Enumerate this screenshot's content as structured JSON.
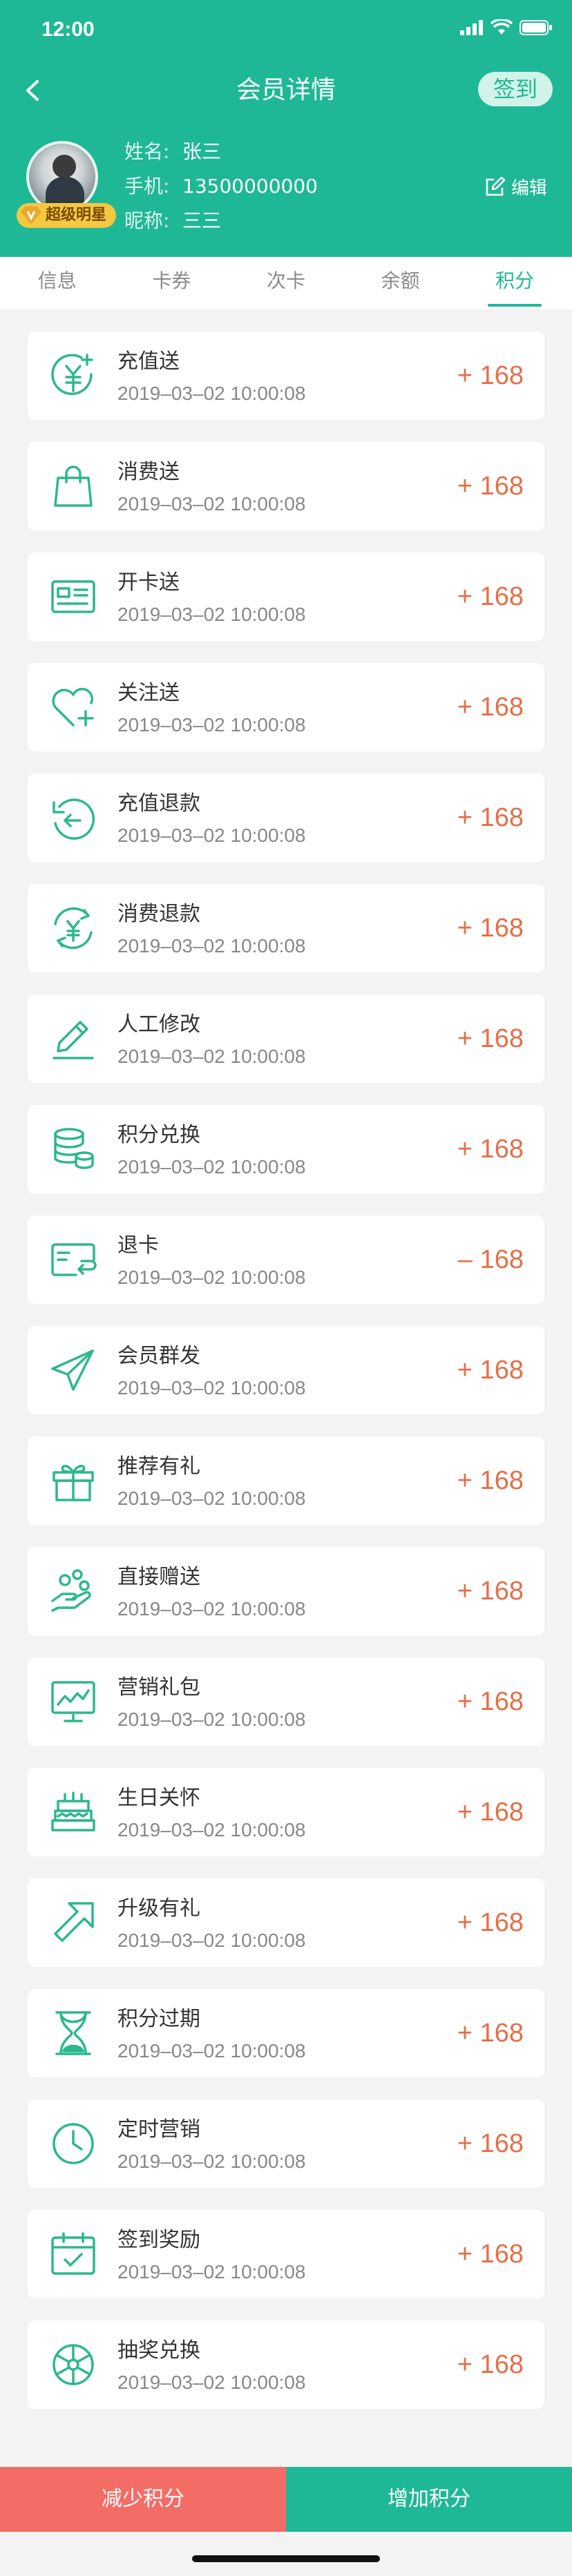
{
  "status_bar": {
    "time": "12:00"
  },
  "navbar": {
    "title": "会员详情",
    "signin_label": "签到"
  },
  "member": {
    "badge": "超级明星",
    "name_label": "姓名:",
    "name": "张三",
    "phone_label": "手机:",
    "phone": "13500000000",
    "nick_label": "昵称:",
    "nick": "三三",
    "edit_label": "编辑"
  },
  "tabs": [
    {
      "label": "信息"
    },
    {
      "label": "卡券"
    },
    {
      "label": "次卡"
    },
    {
      "label": "余额"
    },
    {
      "label": "积分",
      "active": true
    }
  ],
  "records": [
    {
      "icon": "recharge-gift-icon",
      "name": "充值送",
      "date": "2019–03–02  10:00:08",
      "amount": "+ 168"
    },
    {
      "icon": "shopping-bag-icon",
      "name": "消费送",
      "date": "2019–03–02  10:00:08",
      "amount": "+ 168"
    },
    {
      "icon": "member-card-icon",
      "name": "开卡送",
      "date": "2019–03–02  10:00:08",
      "amount": "+ 168"
    },
    {
      "icon": "heart-plus-icon",
      "name": "关注送",
      "date": "2019–03–02  10:00:08",
      "amount": "+ 168"
    },
    {
      "icon": "refund-arrow-icon",
      "name": "充值退款",
      "date": "2019–03–02  10:00:08",
      "amount": "+ 168"
    },
    {
      "icon": "yuan-refund-icon",
      "name": "消费退款",
      "date": "2019–03–02  10:00:08",
      "amount": "+ 168"
    },
    {
      "icon": "pencil-icon",
      "name": "人工修改",
      "date": "2019–03–02  10:00:08",
      "amount": "+ 168"
    },
    {
      "icon": "coins-stack-icon",
      "name": "积分兑换",
      "date": "2019–03–02  10:00:08",
      "amount": "+ 168"
    },
    {
      "icon": "card-return-icon",
      "name": "退卡",
      "date": "2019–03–02  10:00:08",
      "amount": "– 168"
    },
    {
      "icon": "paper-plane-icon",
      "name": "会员群发",
      "date": "2019–03–02  10:00:08",
      "amount": "+ 168"
    },
    {
      "icon": "gift-box-icon",
      "name": "推荐有礼",
      "date": "2019–03–02  10:00:08",
      "amount": "+ 168"
    },
    {
      "icon": "hand-coins-icon",
      "name": "直接赠送",
      "date": "2019–03–02  10:00:08",
      "amount": "+ 168"
    },
    {
      "icon": "chart-screen-icon",
      "name": "营销礼包",
      "date": "2019–03–02  10:00:08",
      "amount": "+ 168"
    },
    {
      "icon": "birthday-cake-icon",
      "name": "生日关怀",
      "date": "2019–03–02  10:00:08",
      "amount": "+ 168"
    },
    {
      "icon": "upgrade-arrow-icon",
      "name": "升级有礼",
      "date": "2019–03–02  10:00:08",
      "amount": "+ 168"
    },
    {
      "icon": "hourglass-icon",
      "name": "积分过期",
      "date": "2019–03–02  10:00:08",
      "amount": "+ 168"
    },
    {
      "icon": "clock-icon",
      "name": "定时营销",
      "date": "2019–03–02  10:00:08",
      "amount": "+ 168"
    },
    {
      "icon": "calendar-check-icon",
      "name": "签到奖励",
      "date": "2019–03–02  10:00:08",
      "amount": "+ 168"
    },
    {
      "icon": "lottery-wheel-icon",
      "name": "抽奖兑换",
      "date": "2019–03–02  10:00:08",
      "amount": "+ 168"
    }
  ],
  "footer": {
    "decrease_label": "减少积分",
    "increase_label": "增加积分"
  },
  "colors": {
    "brand": "#1fb896",
    "amount": "#e46f48",
    "decrease": "#f46c66"
  }
}
